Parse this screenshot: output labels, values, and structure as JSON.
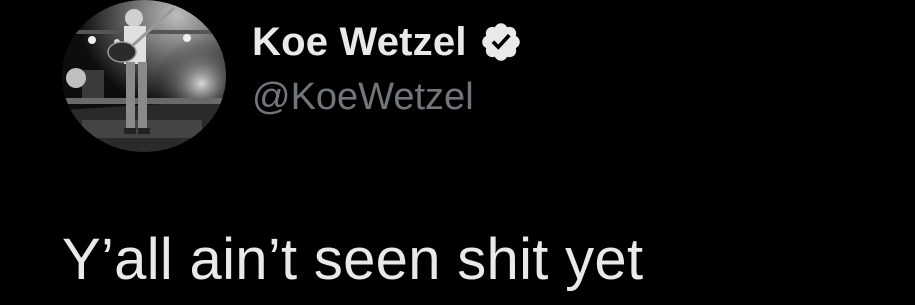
{
  "tweet": {
    "author": {
      "display_name": "Koe Wetzel",
      "handle": "@KoeWetzel",
      "verified": true,
      "avatar_icon": "concert-photo-avatar",
      "verified_icon": "verified-badge-icon"
    },
    "text": "Y’all ain’t seen shit yet"
  },
  "colors": {
    "background": "#000000",
    "primary_text": "#e7e9ea",
    "secondary_text": "#71767b",
    "badge": "#e7e9ea"
  }
}
